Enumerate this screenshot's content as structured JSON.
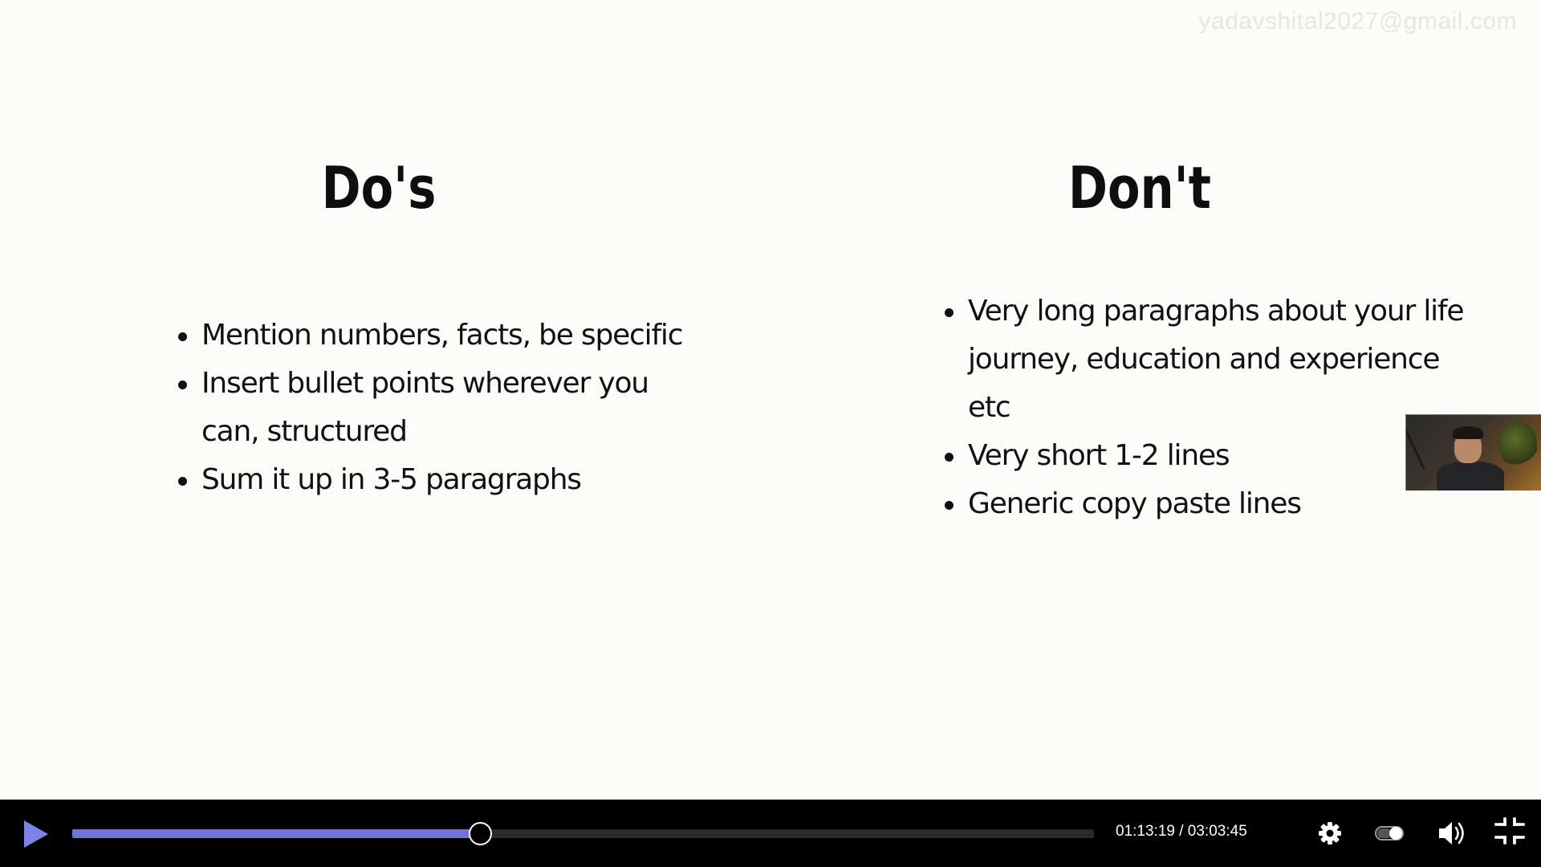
{
  "watermark": "yadavshital2027@gmail.com",
  "slide": {
    "dos": {
      "title": "Do's",
      "items": [
        [
          "Mention numbers, facts, be specific"
        ],
        [
          "Insert bullet points wherever you",
          "can, structured"
        ],
        [
          "Sum it up in 3-5 paragraphs"
        ]
      ]
    },
    "donts": {
      "title": "Don't",
      "items": [
        [
          "Very long paragraphs about your life",
          "journey, education and experience",
          "etc"
        ],
        [
          "Very short 1-2 lines"
        ],
        [
          "Generic copy paste lines"
        ]
      ]
    }
  },
  "player": {
    "current_time": "01:13:19",
    "total_time": "03:03:45",
    "time_display": "01:13:19 / 03:03:45",
    "progress_fraction": 0.399,
    "accent_color": "#6f74d6",
    "icons": {
      "play": "play-icon",
      "settings": "gear-icon",
      "toggle": "toggle-icon",
      "volume": "speaker-icon",
      "exit_fullscreen": "exit-fullscreen-icon"
    }
  }
}
